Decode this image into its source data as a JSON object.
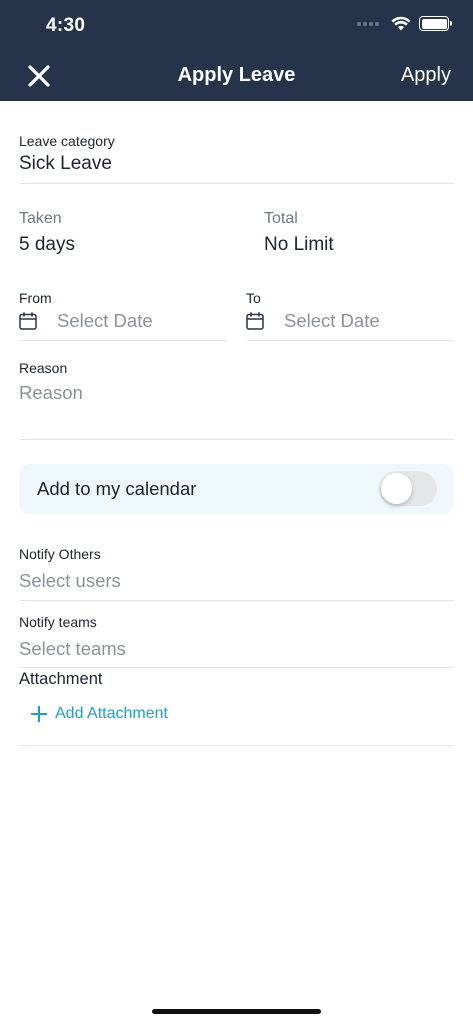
{
  "status_bar": {
    "time": "4:30"
  },
  "nav": {
    "title": "Apply Leave",
    "action": "Apply"
  },
  "leave_category": {
    "label": "Leave category",
    "value": "Sick Leave"
  },
  "taken": {
    "label": "Taken",
    "value": "5 days"
  },
  "total": {
    "label": "Total",
    "value": "No Limit"
  },
  "from": {
    "label": "From",
    "placeholder": "Select Date"
  },
  "to": {
    "label": "To",
    "placeholder": "Select Date"
  },
  "reason": {
    "label": "Reason",
    "placeholder": "Reason"
  },
  "calendar": {
    "label": "Add to my calendar",
    "enabled": false
  },
  "notify_others": {
    "label": "Notify Others",
    "placeholder": "Select users"
  },
  "notify_teams": {
    "label": "Notify teams",
    "placeholder": "Select teams"
  },
  "attachment": {
    "title": "Attachment",
    "add_label": "Add Attachment"
  },
  "colors": {
    "header_bg": "#26344b",
    "accent": "#1b9fd0",
    "calendar_bg": "#eef7fb"
  }
}
